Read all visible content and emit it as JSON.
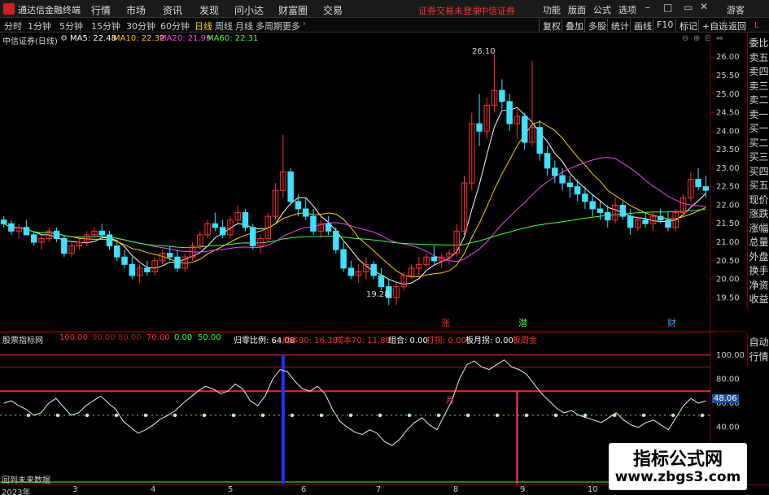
{
  "titlebar": {
    "app_name": "通达信金融终端",
    "menus": [
      "行情",
      "市场",
      "资讯",
      "发现",
      "问小达",
      "财富圈",
      "交易"
    ],
    "warning": "证券交易未登录",
    "broker": "中信证券",
    "right_menus": [
      "功能",
      "版面",
      "公式",
      "选项"
    ],
    "guest": "游客"
  },
  "periods": [
    "分时",
    "1分钟",
    "5分钟",
    "15分钟",
    "30分钟",
    "60分钟",
    "日线",
    "周线",
    "月线",
    "多周期",
    "更多"
  ],
  "active_period": "日线",
  "right_tools": [
    "复权",
    "叠加",
    "多股",
    "统计",
    "画线",
    "F10",
    "标记",
    "+自选",
    "返回"
  ],
  "chart_title": "中信证券(日线)",
  "ma_legend": [
    {
      "label": "MA5: 22.48",
      "color": "#ffffff"
    },
    {
      "label": "MA10: 22.32",
      "color": "#ffd000"
    },
    {
      "label": "MA20: 21.99",
      "color": "#ff40ff"
    },
    {
      "label": "MA60: 22.31",
      "color": "#40ff40"
    }
  ],
  "side_panel": [
    "委比",
    "卖五",
    "卖四",
    "卖三",
    "卖二",
    "卖一",
    "买一",
    "买二",
    "买三",
    "买四",
    "买五",
    "现价",
    "涨跌",
    "涨幅",
    "总量",
    "外盘",
    "换手",
    "净资",
    "收益"
  ],
  "side_panel_lower": [
    "自动",
    "行情"
  ],
  "side_top_label": "L",
  "price_high_label": "26.10",
  "price_low_label": "19.28",
  "event_labels": [
    {
      "text": "涨",
      "color": "#ff3030"
    },
    {
      "text": "潜",
      "color": "#40ff40"
    },
    {
      "text": "财",
      "color": "#40a0ff"
    }
  ],
  "indicator_header": [
    {
      "text": "股票指标网",
      "color": "#ddd"
    },
    {
      "text": "100.00",
      "color": "#ff3030"
    },
    {
      "text": "90.00",
      "color": "#a02020"
    },
    {
      "text": "80.00",
      "color": "#a02020"
    },
    {
      "text": "70.00",
      "color": "#ff3030"
    },
    {
      "text": "0.00",
      "color": "#40ff40"
    },
    {
      "text": "50.00",
      "color": "#40ff40"
    },
    {
      "text": "归零比例: 64.08",
      "color": "#ffffff"
    },
    {
      "text": "成本90: 16.38",
      "color": "#ff3030"
    },
    {
      "text": "成本70: 11.88",
      "color": "#ff3030"
    },
    {
      "text": "组合: 0.00",
      "color": "#ffffff"
    },
    {
      "text": "打拐: 0.00",
      "color": "#ff3030"
    },
    {
      "text": "板月拐: 0.00",
      "color": "#ffffff"
    },
    {
      "text": "板周金",
      "color": "#ff3030"
    }
  ],
  "indicator_marker": "月",
  "indicator_value": "48.06",
  "bottom_note": "回到未来数据",
  "x_labels": [
    "2023年",
    "3",
    "4",
    "5",
    "6",
    "7",
    "8",
    "9",
    "10"
  ],
  "watermark": {
    "line1": "指标公式网",
    "line2": "www.zbgs3.com"
  },
  "price_axis": [
    "26.00",
    "25.50",
    "25.00",
    "24.50",
    "24.00",
    "23.50",
    "23.00",
    "22.50",
    "22.00",
    "21.50",
    "21.00",
    "20.50",
    "20.00",
    "19.50"
  ],
  "indicator_axis": [
    "100.00",
    "80.00",
    "60.00",
    "40.00"
  ],
  "chart_data": {
    "type": "candlestick",
    "price_range": [
      19.2,
      26.4
    ],
    "candles": [
      [
        21.6,
        21.7,
        21.4,
        21.5
      ],
      [
        21.5,
        21.6,
        21.2,
        21.3
      ],
      [
        21.3,
        21.5,
        21.1,
        21.4
      ],
      [
        21.4,
        21.6,
        21.2,
        21.2
      ],
      [
        21.2,
        21.3,
        20.9,
        21.0
      ],
      [
        21.0,
        21.2,
        20.8,
        21.1
      ],
      [
        21.1,
        21.4,
        21.0,
        21.3
      ],
      [
        21.3,
        21.4,
        21.0,
        21.1
      ],
      [
        21.1,
        21.2,
        20.6,
        20.7
      ],
      [
        20.7,
        21.0,
        20.6,
        20.9
      ],
      [
        20.9,
        21.1,
        20.8,
        21.0
      ],
      [
        21.0,
        21.3,
        20.9,
        21.2
      ],
      [
        21.2,
        21.4,
        21.1,
        21.3
      ],
      [
        21.3,
        21.5,
        21.1,
        21.2
      ],
      [
        21.2,
        21.3,
        20.8,
        20.9
      ],
      [
        20.9,
        21.0,
        20.5,
        20.6
      ],
      [
        20.6,
        20.8,
        20.3,
        20.4
      ],
      [
        20.4,
        20.6,
        20.0,
        20.1
      ],
      [
        20.1,
        20.4,
        19.9,
        20.3
      ],
      [
        20.3,
        20.5,
        20.1,
        20.2
      ],
      [
        20.2,
        20.6,
        20.1,
        20.5
      ],
      [
        20.5,
        20.8,
        20.4,
        20.7
      ],
      [
        20.7,
        20.9,
        20.5,
        20.6
      ],
      [
        20.6,
        20.8,
        20.2,
        20.3
      ],
      [
        20.3,
        20.7,
        20.2,
        20.6
      ],
      [
        20.6,
        21.0,
        20.5,
        20.9
      ],
      [
        20.9,
        21.3,
        20.8,
        21.2
      ],
      [
        21.2,
        21.6,
        21.1,
        21.5
      ],
      [
        21.5,
        21.8,
        21.3,
        21.4
      ],
      [
        21.4,
        21.6,
        21.1,
        21.2
      ],
      [
        21.2,
        21.7,
        21.1,
        21.6
      ],
      [
        21.6,
        22.0,
        21.5,
        21.8
      ],
      [
        21.8,
        21.9,
        21.3,
        21.4
      ],
      [
        21.4,
        21.5,
        20.8,
        20.9
      ],
      [
        20.9,
        21.2,
        20.7,
        21.1
      ],
      [
        21.1,
        21.8,
        21.0,
        21.7
      ],
      [
        21.7,
        22.6,
        21.6,
        22.4
      ],
      [
        22.4,
        23.9,
        22.2,
        22.9
      ],
      [
        22.9,
        23.0,
        22.0,
        22.1
      ],
      [
        22.1,
        22.3,
        21.7,
        21.9
      ],
      [
        21.9,
        22.2,
        21.6,
        21.7
      ],
      [
        21.7,
        21.9,
        21.2,
        21.3
      ],
      [
        21.3,
        21.6,
        21.1,
        21.5
      ],
      [
        21.5,
        21.7,
        21.2,
        21.3
      ],
      [
        21.3,
        21.4,
        20.7,
        20.8
      ],
      [
        20.8,
        21.0,
        20.2,
        20.3
      ],
      [
        20.3,
        20.5,
        20.0,
        20.1
      ],
      [
        20.1,
        20.4,
        19.9,
        20.2
      ],
      [
        20.2,
        20.6,
        20.0,
        20.4
      ],
      [
        20.4,
        20.5,
        20.0,
        20.1
      ],
      [
        20.1,
        20.3,
        19.7,
        19.8
      ],
      [
        19.8,
        20.0,
        19.3,
        19.5
      ],
      [
        19.5,
        19.9,
        19.3,
        19.8
      ],
      [
        19.8,
        20.2,
        19.7,
        20.1
      ],
      [
        20.1,
        20.4,
        20.0,
        20.3
      ],
      [
        20.3,
        20.6,
        20.1,
        20.4
      ],
      [
        20.4,
        20.7,
        20.3,
        20.6
      ],
      [
        20.6,
        20.9,
        20.4,
        20.5
      ],
      [
        20.5,
        20.7,
        20.3,
        20.6
      ],
      [
        20.6,
        20.8,
        20.4,
        20.7
      ],
      [
        20.7,
        21.5,
        20.6,
        21.3
      ],
      [
        21.3,
        22.8,
        21.2,
        22.6
      ],
      [
        22.6,
        24.5,
        22.4,
        24.2
      ],
      [
        24.2,
        25.0,
        23.6,
        24.0
      ],
      [
        24.0,
        24.9,
        23.8,
        24.7
      ],
      [
        24.7,
        26.1,
        24.5,
        25.1
      ],
      [
        25.1,
        25.4,
        24.6,
        24.8
      ],
      [
        24.8,
        25.0,
        24.0,
        24.2
      ],
      [
        24.2,
        24.6,
        23.8,
        24.4
      ],
      [
        24.4,
        24.5,
        23.5,
        23.7
      ],
      [
        23.7,
        25.9,
        23.6,
        24.1
      ],
      [
        24.1,
        24.3,
        23.2,
        23.4
      ],
      [
        23.4,
        23.6,
        22.8,
        23.0
      ],
      [
        23.0,
        23.2,
        22.6,
        22.8
      ],
      [
        22.8,
        23.0,
        22.4,
        22.6
      ],
      [
        22.6,
        22.8,
        22.2,
        22.5
      ],
      [
        22.5,
        22.7,
        22.1,
        22.3
      ],
      [
        22.3,
        22.5,
        21.9,
        22.1
      ],
      [
        22.1,
        22.3,
        21.7,
        21.9
      ],
      [
        21.9,
        22.1,
        21.6,
        21.8
      ],
      [
        21.8,
        22.0,
        21.4,
        21.6
      ],
      [
        21.6,
        22.2,
        21.5,
        22.0
      ],
      [
        22.0,
        22.1,
        21.6,
        21.7
      ],
      [
        21.7,
        21.9,
        21.2,
        21.4
      ],
      [
        21.4,
        21.7,
        21.3,
        21.6
      ],
      [
        21.6,
        21.8,
        21.4,
        21.5
      ],
      [
        21.5,
        21.8,
        21.3,
        21.7
      ],
      [
        21.7,
        21.9,
        21.5,
        21.6
      ],
      [
        21.6,
        21.8,
        21.3,
        21.4
      ],
      [
        21.4,
        21.9,
        21.3,
        21.8
      ],
      [
        21.8,
        22.3,
        21.7,
        22.2
      ],
      [
        22.2,
        22.9,
        22.1,
        22.7
      ],
      [
        22.7,
        23.0,
        22.4,
        22.5
      ],
      [
        22.5,
        22.8,
        22.2,
        22.4
      ]
    ],
    "indicator": [
      60,
      62,
      58,
      55,
      50,
      52,
      60,
      64,
      57,
      50,
      52,
      58,
      62,
      66,
      60,
      55,
      45,
      40,
      35,
      38,
      42,
      47,
      50,
      54,
      60,
      65,
      70,
      74,
      72,
      68,
      70,
      76,
      72,
      62,
      58,
      66,
      80,
      88,
      86,
      78,
      72,
      70,
      74,
      68,
      55,
      45,
      40,
      36,
      34,
      38,
      35,
      28,
      25,
      30,
      38,
      44,
      48,
      42,
      38,
      50,
      62,
      80,
      92,
      95,
      90,
      88,
      92,
      96,
      90,
      88,
      84,
      76,
      68,
      62,
      56,
      52,
      54,
      50,
      48,
      46,
      44,
      48,
      52,
      46,
      42,
      40,
      44,
      46,
      42,
      38,
      48,
      58,
      64,
      60,
      62
    ],
    "indicator_range": [
      0,
      110
    ]
  }
}
